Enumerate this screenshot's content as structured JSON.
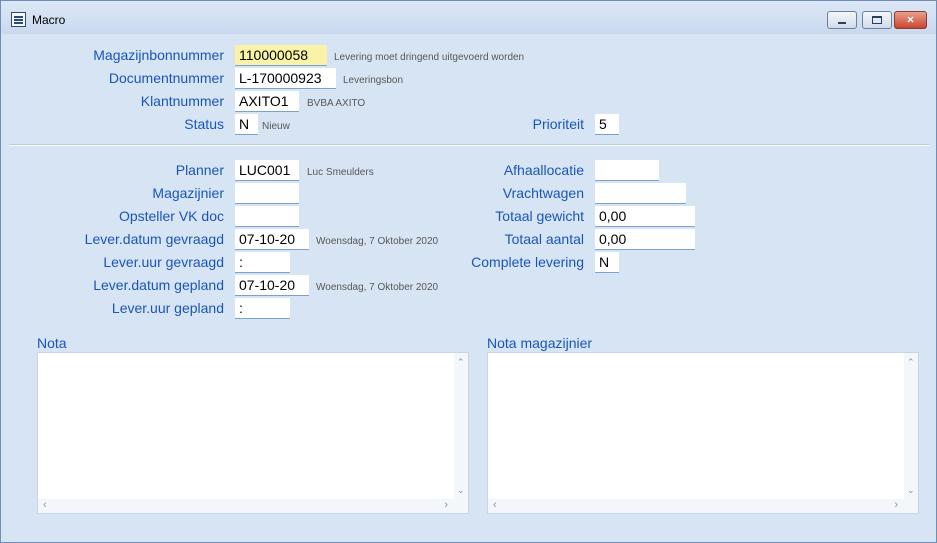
{
  "window": {
    "title": "Macro",
    "minimize_label": "minimize",
    "maximize_label": "maximize",
    "close_label": "×"
  },
  "header": {
    "magazijnbonnummer": {
      "label": "Magazijnbonnummer",
      "value": "110000058",
      "note": "Levering moet dringend uitgevoerd worden"
    },
    "documentnummer": {
      "label": "Documentnummer",
      "value": "L-170000923",
      "note": "Leveringsbon"
    },
    "klantnummer": {
      "label": "Klantnummer",
      "value": "AXITO1",
      "note": "BVBA AXITO"
    },
    "status": {
      "label": "Status",
      "value": "N",
      "note": "Nieuw"
    },
    "prioriteit": {
      "label": "Prioriteit",
      "value": "5"
    }
  },
  "left": {
    "planner": {
      "label": "Planner",
      "value": "LUC001",
      "note": "Luc Smeulders"
    },
    "magazijnier": {
      "label": "Magazijnier",
      "value": ""
    },
    "opsteller": {
      "label": "Opsteller VK doc",
      "value": ""
    },
    "leverdatum_gevraagd": {
      "label": "Lever.datum gevraagd",
      "value": "07-10-20",
      "note": "Woensdag, 7 Oktober 2020"
    },
    "leveruur_gevraagd": {
      "label": "Lever.uur gevraagd",
      "value": ":"
    },
    "leverdatum_gepland": {
      "label": "Lever.datum gepland",
      "value": "07-10-20",
      "note": "Woensdag, 7 Oktober 2020"
    },
    "leveruur_gepland": {
      "label": "Lever.uur gepland",
      "value": ":"
    }
  },
  "right": {
    "afhaallocatie": {
      "label": "Afhaallocatie",
      "value": ""
    },
    "vrachtwagen": {
      "label": "Vrachtwagen",
      "value": ""
    },
    "totaal_gewicht": {
      "label": "Totaal gewicht",
      "value": "0,00"
    },
    "totaal_aantal": {
      "label": "Totaal aantal",
      "value": "0,00"
    },
    "complete_levering": {
      "label": "Complete levering",
      "value": "N"
    }
  },
  "notes": {
    "nota": {
      "label": "Nota",
      "value": ""
    },
    "nota_magazijnier": {
      "label": "Nota magazijnier",
      "value": ""
    }
  },
  "colors": {
    "label": "#1a56b7",
    "highlight": "#faf2a6",
    "background": "#d6e4f3"
  }
}
